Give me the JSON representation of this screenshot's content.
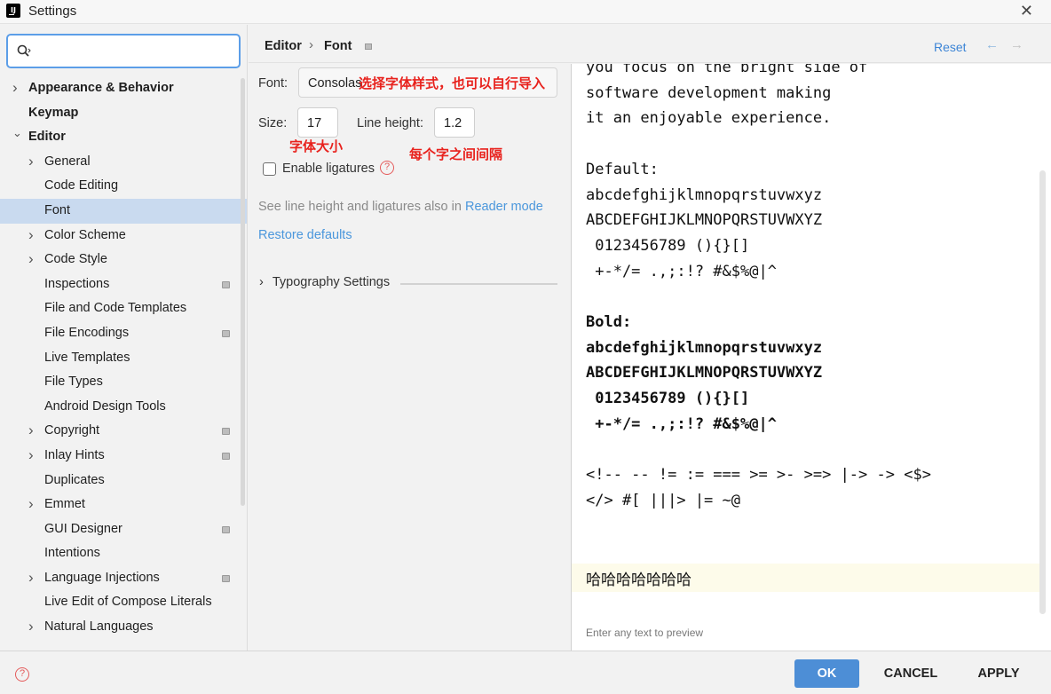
{
  "window": {
    "title": "Settings",
    "close": "✕"
  },
  "search": {
    "placeholder": "",
    "value": ""
  },
  "sidebar": {
    "items": [
      {
        "label": "Appearance & Behavior",
        "level": 0,
        "expander": "collapsed",
        "bold": true
      },
      {
        "label": "Keymap",
        "level": 0,
        "expander": "none",
        "bold": true
      },
      {
        "label": "Editor",
        "level": 0,
        "expander": "expanded",
        "bold": true
      },
      {
        "label": "General",
        "level": 1,
        "expander": "collapsed"
      },
      {
        "label": "Code Editing",
        "level": 1,
        "expander": "none"
      },
      {
        "label": "Font",
        "level": 1,
        "expander": "none",
        "selected": true
      },
      {
        "label": "Color Scheme",
        "level": 1,
        "expander": "collapsed"
      },
      {
        "label": "Code Style",
        "level": 1,
        "expander": "collapsed"
      },
      {
        "label": "Inspections",
        "level": 1,
        "expander": "none",
        "project": true
      },
      {
        "label": "File and Code Templates",
        "level": 1,
        "expander": "none"
      },
      {
        "label": "File Encodings",
        "level": 1,
        "expander": "none",
        "project": true
      },
      {
        "label": "Live Templates",
        "level": 1,
        "expander": "none"
      },
      {
        "label": "File Types",
        "level": 1,
        "expander": "none"
      },
      {
        "label": "Android Design Tools",
        "level": 1,
        "expander": "none"
      },
      {
        "label": "Copyright",
        "level": 1,
        "expander": "collapsed",
        "project": true
      },
      {
        "label": "Inlay Hints",
        "level": 1,
        "expander": "collapsed",
        "project": true
      },
      {
        "label": "Duplicates",
        "level": 1,
        "expander": "none"
      },
      {
        "label": "Emmet",
        "level": 1,
        "expander": "collapsed"
      },
      {
        "label": "GUI Designer",
        "level": 1,
        "expander": "none",
        "project": true
      },
      {
        "label": "Intentions",
        "level": 1,
        "expander": "none"
      },
      {
        "label": "Language Injections",
        "level": 1,
        "expander": "collapsed",
        "project": true
      },
      {
        "label": "Live Edit of Compose Literals",
        "level": 1,
        "expander": "none"
      },
      {
        "label": "Natural Languages",
        "level": 1,
        "expander": "collapsed"
      }
    ]
  },
  "breadcrumb": {
    "editor": "Editor",
    "separator": "›",
    "current": "Font"
  },
  "header": {
    "reset": "Reset",
    "back": "←",
    "forward": "→"
  },
  "form": {
    "font_label": "Font:",
    "font_value": "Consolas",
    "font_annotation": "选择字体样式，也可以自行导入",
    "size_label": "Size:",
    "size_value": "17",
    "size_annotation": "字体大小",
    "line_height_label": "Line height:",
    "line_height_value": "1.2",
    "line_height_annotation": "每个字之间间隔",
    "ligatures_label": "Enable ligatures",
    "ligatures_checked": false,
    "hint_text": "See line height and ligatures also in ",
    "reader_mode_link": "Reader mode",
    "restore_defaults": "Restore defaults",
    "typography": "Typography Settings"
  },
  "preview": {
    "lines": [
      "you focus on the bright side of",
      "software development making",
      "it an enjoyable experience.",
      "",
      "Default:",
      "abcdefghijklmnopqrstuvwxyz",
      "ABCDEFGHIJKLMNOPQRSTUVWXYZ",
      " 0123456789 (){}[]",
      " +-*/= .,;:!? #&$%@|^",
      "",
      "Bold:",
      "abcdefghijklmnopqrstuvwxyz",
      "ABCDEFGHIJKLMNOPQRSTUVWXYZ",
      " 0123456789 (){}[]",
      " +-*/= .,;:!? #&$%@|^",
      "",
      "<!-- -- != := === >= >- >=> |-> -> <$>",
      "</> #[ |||> |= ~@"
    ],
    "bold_range": [
      10,
      14
    ],
    "custom_text": "哈哈哈哈哈哈哈",
    "placeholder": "Enter any text to preview"
  },
  "footer": {
    "ok": "OK",
    "cancel": "CANCEL",
    "apply": "APPLY",
    "help": "?"
  },
  "colors": {
    "accent": "#4d8ed6",
    "selection": "#c9daef",
    "annotation": "#e8221d",
    "link": "#4b97dc"
  }
}
